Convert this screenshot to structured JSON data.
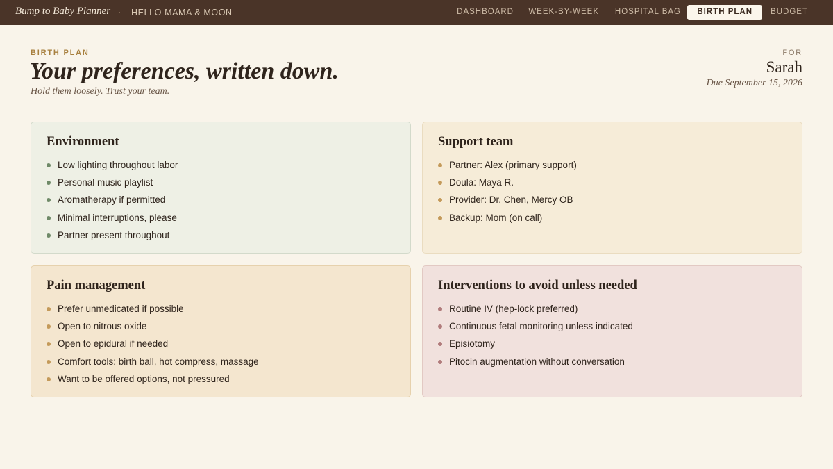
{
  "app": {
    "brand": "Bump to Baby Planner",
    "separator": "·",
    "tagline": "HELLO MAMA & MOON"
  },
  "nav": {
    "items": [
      {
        "label": "DASHBOARD"
      },
      {
        "label": "WEEK-BY-WEEK"
      },
      {
        "label": "HOSPITAL BAG"
      },
      {
        "label": "BIRTH PLAN",
        "active": true
      },
      {
        "label": "BUDGET"
      }
    ]
  },
  "header": {
    "eyebrow": "BIRTH PLAN",
    "title": "Your preferences, written down.",
    "subtitle": "Hold them loosely. Trust your team.",
    "for_label": "FOR",
    "name": "Sarah",
    "due": "Due September 15, 2026"
  },
  "cards": {
    "environment": {
      "title": "Environment",
      "items": [
        "Low lighting throughout labor",
        "Personal music playlist",
        "Aromatherapy if permitted",
        "Minimal interruptions, please",
        "Partner present throughout"
      ]
    },
    "support_team": {
      "title": "Support team",
      "items": [
        "Partner: Alex (primary support)",
        "Doula: Maya R.",
        "Provider: Dr. Chen, Mercy OB",
        "Backup: Mom (on call)"
      ]
    },
    "pain_management": {
      "title": "Pain management",
      "items": [
        "Prefer unmedicated if possible",
        "Open to nitrous oxide",
        "Open to epidural if needed",
        "Comfort tools: birth ball, hot compress, massage",
        "Want to be offered options, not pressured"
      ]
    },
    "interventions": {
      "title": "Interventions to avoid unless needed",
      "items": [
        "Routine IV (hep-lock preferred)",
        "Continuous fetal monitoring unless indicated",
        "Episiotomy",
        "Pitocin augmentation without conversation"
      ]
    }
  },
  "colors": {
    "topbar": "#4a3428",
    "page_background": "#f9f4ea",
    "accent": "#a8803f",
    "environment_card": "#eef0e5",
    "support_card": "#f6ecd8",
    "pain_card": "#f4e6cf",
    "interventions_card": "#f1e1dd"
  }
}
